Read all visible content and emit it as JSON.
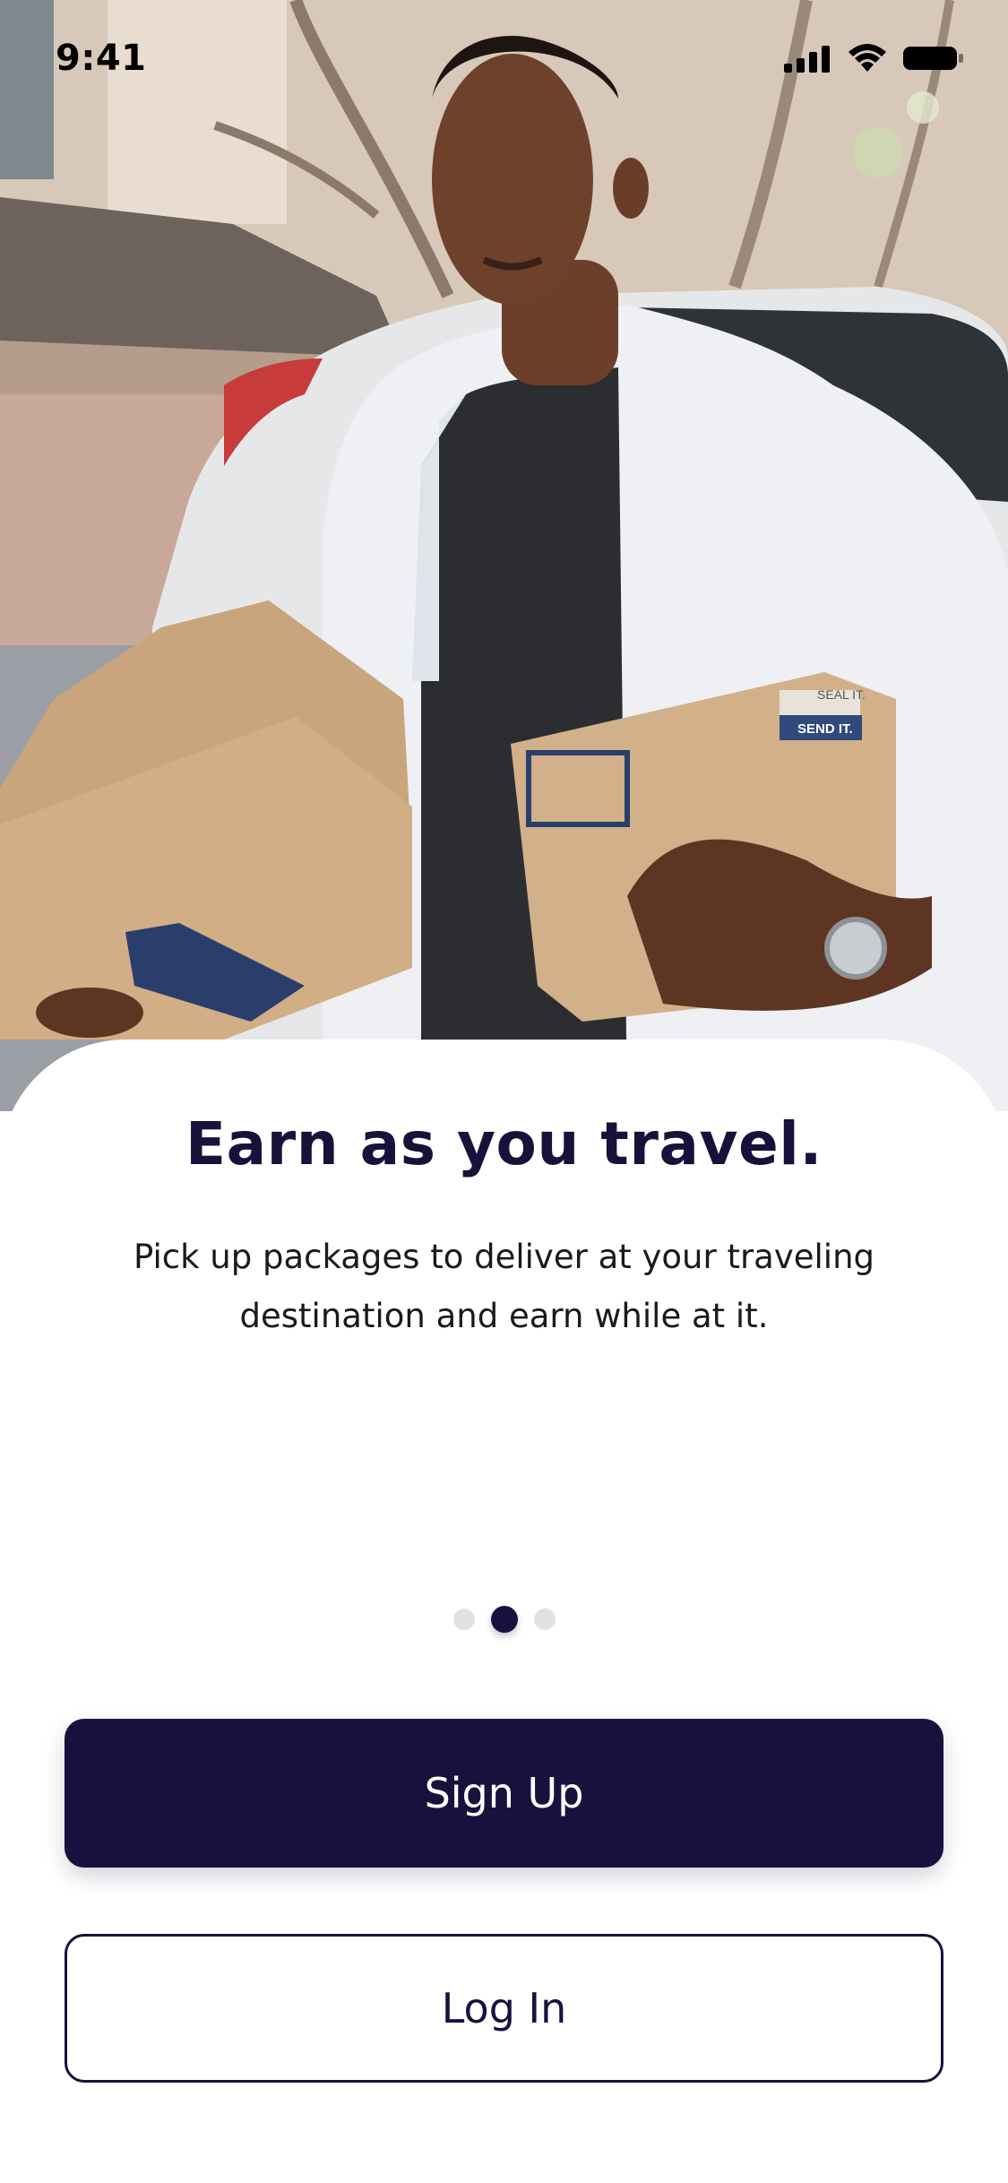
{
  "status_bar": {
    "time": "9:41",
    "icons": [
      "cellular-signal-icon",
      "wifi-icon",
      "battery-icon"
    ]
  },
  "hero": {
    "image": "man-holding-cardboard-boxes-photo",
    "box_labels": [
      "SEAL IT.",
      "SEND IT."
    ]
  },
  "onboarding": {
    "title": "Earn as you travel.",
    "description": "Pick up packages to deliver at your traveling destination and earn while at it.",
    "page_count": 3,
    "active_page": 2
  },
  "actions": {
    "sign_up_label": "Sign Up",
    "log_in_label": "Log In"
  },
  "colors": {
    "primary": "#17123d",
    "background": "#ffffff",
    "dot_inactive": "#e2e2e6"
  }
}
